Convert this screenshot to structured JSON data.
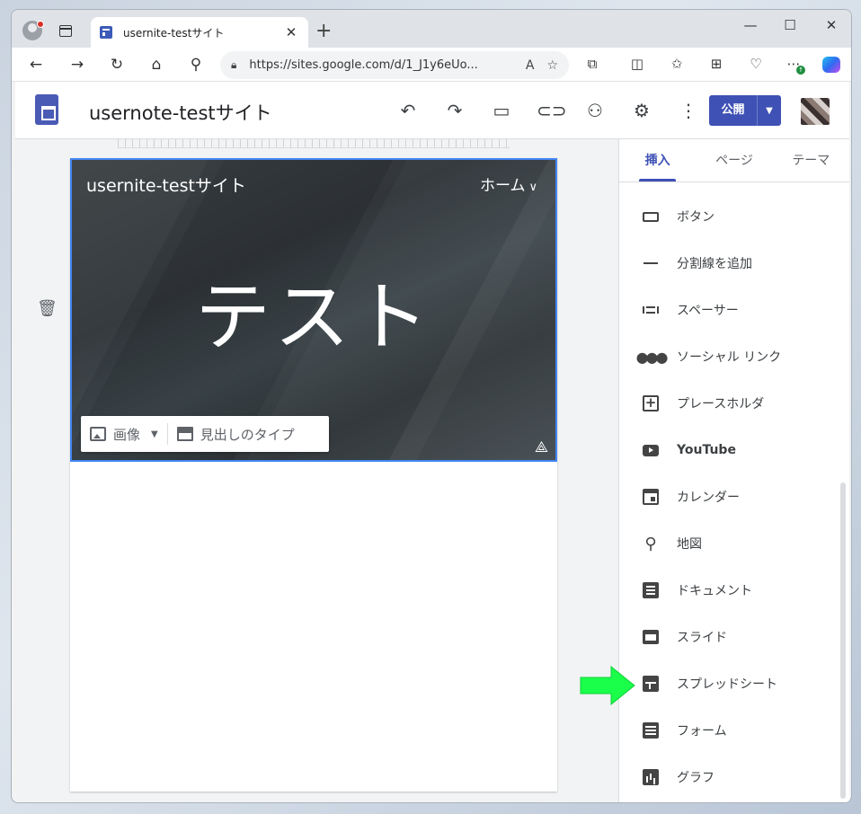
{
  "browser": {
    "tab_title": "usernite-testサイト",
    "url": "https://sites.google.com/d/1_J1y6eUo..."
  },
  "header": {
    "site_title": "usernote-testサイト",
    "publish_label": "公開"
  },
  "banner": {
    "site_name": "usernite-testサイト",
    "nav_home": "ホーム",
    "title": "テスト",
    "image_button": "画像",
    "header_type_button": "見出しのタイプ"
  },
  "panel": {
    "tabs": [
      "挿入",
      "ページ",
      "テーマ"
    ],
    "items": [
      {
        "label": "ボタン",
        "icon": "button-icon"
      },
      {
        "label": "分割線を追加",
        "icon": "divider-icon"
      },
      {
        "label": "スペーサー",
        "icon": "spacer-icon"
      },
      {
        "label": "ソーシャル リンク",
        "icon": "social-links-icon"
      },
      {
        "label": "プレースホルダ",
        "icon": "placeholder-icon"
      },
      {
        "label": "YouTube",
        "icon": "youtube-icon"
      },
      {
        "label": "カレンダー",
        "icon": "calendar-icon"
      },
      {
        "label": "地図",
        "icon": "map-pin-icon"
      },
      {
        "label": "ドキュメント",
        "icon": "docs-icon"
      },
      {
        "label": "スライド",
        "icon": "slides-icon"
      },
      {
        "label": "スプレッドシート",
        "icon": "sheets-icon"
      },
      {
        "label": "フォーム",
        "icon": "forms-icon"
      },
      {
        "label": "グラフ",
        "icon": "chart-icon"
      }
    ]
  },
  "colors": {
    "accent": "#3f51b5",
    "arrow": "#1aff4a",
    "selection": "#4285f4"
  }
}
